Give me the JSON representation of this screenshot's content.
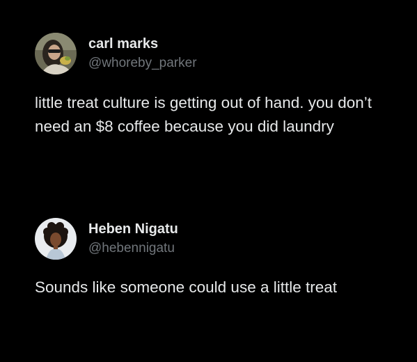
{
  "posts": [
    {
      "author": {
        "display_name": "carl marks",
        "handle": "@whoreby_parker",
        "avatar_icon": "profile-photo-woman-with-sunglasses"
      },
      "text": "little treat culture is getting out of hand. you don’t need an $8 coffee because you did laundry"
    },
    {
      "author": {
        "display_name": "Heben Nigatu",
        "handle": "@hebennigatu",
        "avatar_icon": "profile-photo-curly-hair"
      },
      "text": "Sounds like someone could use a little treat"
    }
  ],
  "colors": {
    "background": "#000000",
    "primary_text": "#e7e9ea",
    "secondary_text": "#71767b"
  }
}
